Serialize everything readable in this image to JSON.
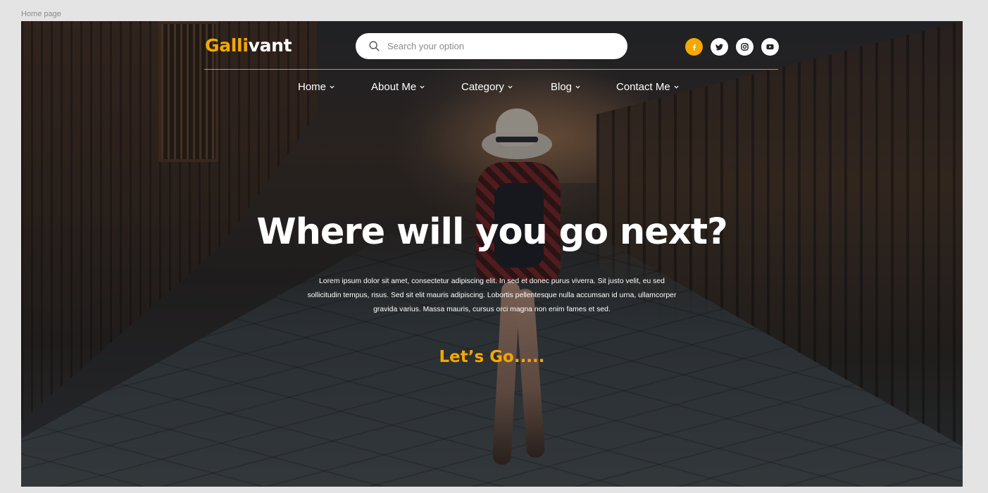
{
  "frame": {
    "label": "Home page"
  },
  "header": {
    "logo": {
      "accent": "Galli",
      "rest": "vant"
    },
    "search": {
      "placeholder": "Search your option",
      "value": ""
    },
    "social": [
      {
        "name": "facebook",
        "active": true
      },
      {
        "name": "twitter",
        "active": false
      },
      {
        "name": "instagram",
        "active": false
      },
      {
        "name": "youtube",
        "active": false
      }
    ]
  },
  "nav": {
    "items": [
      {
        "label": "Home"
      },
      {
        "label": "About Me"
      },
      {
        "label": "Category"
      },
      {
        "label": "Blog"
      },
      {
        "label": "Contact Me"
      }
    ]
  },
  "hero": {
    "headline": "Where will you go next?",
    "intro_lines": [
      "Lorem ipsum dolor sit amet, consectetur adipiscing elit. In sed et donec purus viverra. Sit justo velit, eu sed",
      "sollicitudin tempus, risus. Sed sit elit mauris adipiscing. Lobortis pellentesque nulla accumsan id urna, ullamcorper",
      "gravida varius. Massa mauris, cursus orci magna non enim fames et sed."
    ],
    "cta": "Let’s Go....."
  },
  "colors": {
    "accent": "#f5a800",
    "text_light": "#ffffff",
    "canvas": "#e4e4e4"
  },
  "icons": {
    "search": "search-icon",
    "facebook": "facebook-icon",
    "twitter": "twitter-icon",
    "instagram": "instagram-icon",
    "youtube": "youtube-icon",
    "chevron": "chevron-down-icon"
  }
}
